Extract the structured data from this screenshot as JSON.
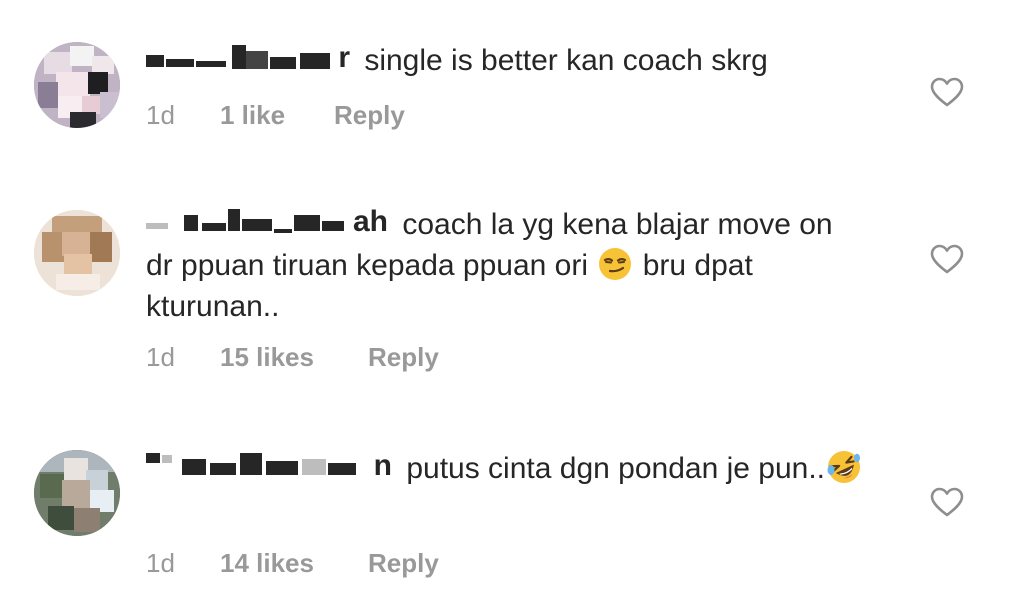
{
  "comments": [
    {
      "username_visible": "r",
      "text": "single is better kan coach skrg",
      "time": "1d",
      "likes": "1 like",
      "reply_label": "Reply",
      "like_icon": "heart-outline-icon"
    },
    {
      "username_visible": "ah",
      "text": "coach la yg kena blajar move on dr ppuan tiruan kepada ppuan ori",
      "emoji": "smirking-face-emoji",
      "text_after_emoji": "bru dpat kturunan..",
      "time": "1d",
      "likes": "15 likes",
      "reply_label": "Reply",
      "like_icon": "heart-outline-icon"
    },
    {
      "username_visible": "n",
      "text": "putus cinta dgn pondan je pun..",
      "emoji": "rolling-on-floor-laughing-emoji",
      "time": "1d",
      "likes": "14 likes",
      "reply_label": "Reply",
      "like_icon": "heart-outline-icon"
    }
  ],
  "colors": {
    "text": "#262626",
    "meta": "#999999",
    "heart": "#8e8e8e",
    "censor": "#262626"
  }
}
